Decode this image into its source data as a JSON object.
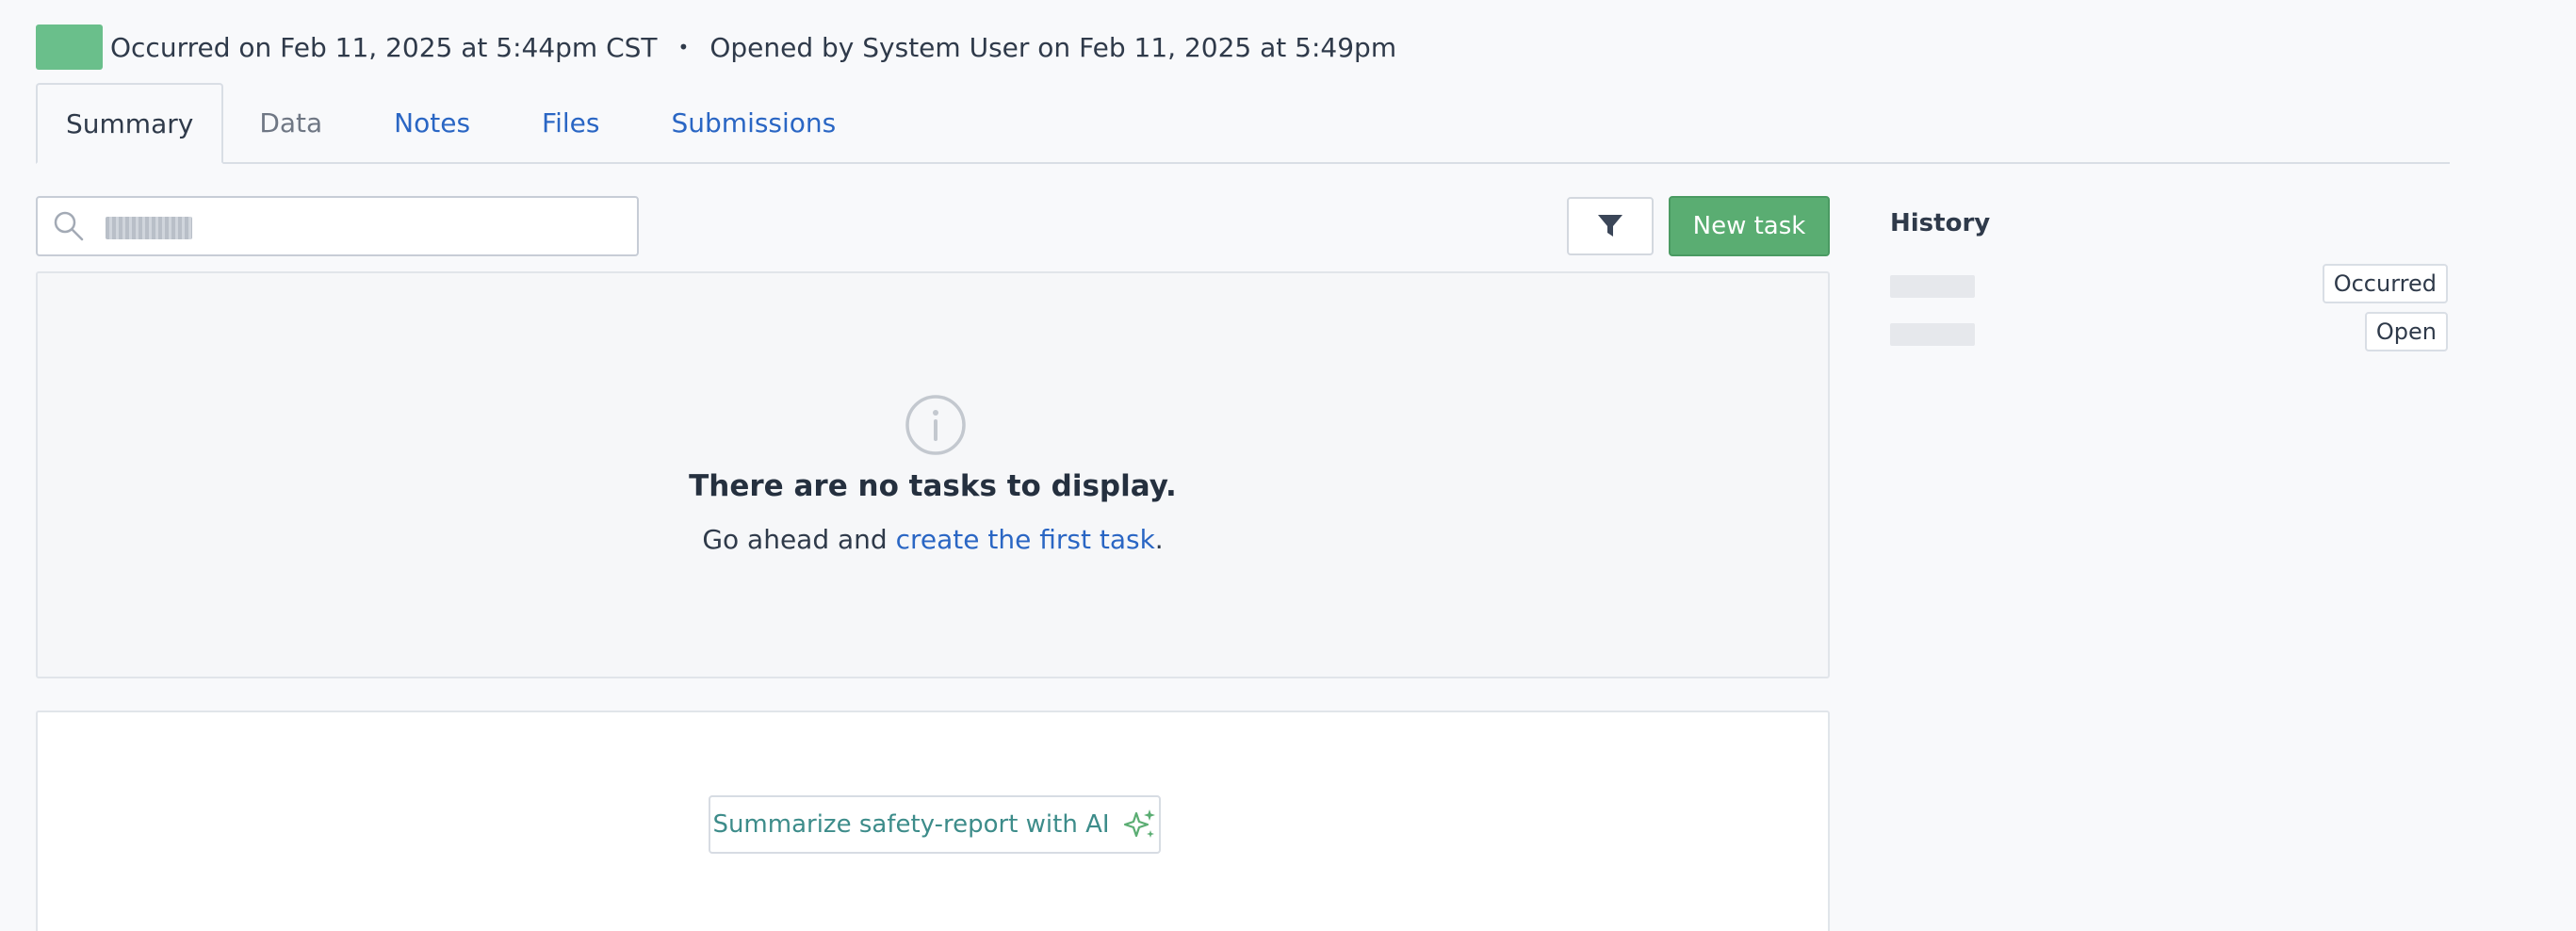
{
  "header": {
    "occurred_text": "Occurred on Feb 11, 2025 at 5:44pm CST",
    "separator": "•",
    "opened_text": "Opened by System User on Feb 11, 2025 at 5:49pm"
  },
  "tabs": [
    {
      "label": "Summary",
      "state": "active"
    },
    {
      "label": "Data",
      "state": "muted"
    },
    {
      "label": "Notes",
      "state": "link"
    },
    {
      "label": "Files",
      "state": "link"
    },
    {
      "label": "Submissions",
      "state": "link"
    }
  ],
  "search": {
    "value": "",
    "placeholder": ""
  },
  "toolbar": {
    "new_task_label": "New task"
  },
  "tasks": {
    "empty_title": "There are no tasks to display.",
    "empty_prefix": "Go ahead and ",
    "empty_link": "create the first task",
    "empty_suffix": "."
  },
  "ai": {
    "button_label": "Summarize safety-report with AI"
  },
  "history": {
    "title": "History",
    "entries": [
      {
        "badge": "Occurred"
      },
      {
        "badge": "Open"
      }
    ]
  },
  "colors": {
    "status_chip": "#6abf8b",
    "primary_button": "#5aad72",
    "link": "#2a66c4",
    "ai_accent": "#3d8c8a"
  },
  "icons": {
    "search": "search-icon",
    "filter": "filter-icon",
    "info": "info-icon",
    "ai": "sparkles-icon"
  }
}
